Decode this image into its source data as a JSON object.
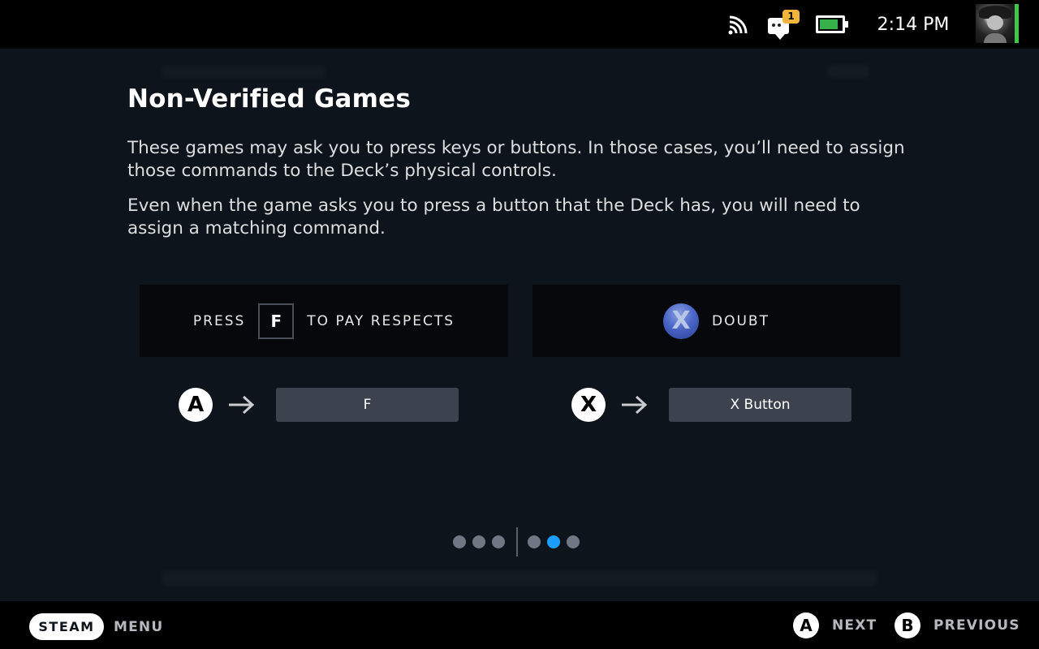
{
  "status_bar": {
    "cast_icon": "cast-icon",
    "notifications": {
      "icon": "chat-icon",
      "badge_count": "1",
      "badge_color": "#f1b53b"
    },
    "battery": {
      "icon": "battery-icon",
      "level_fraction": 0.85,
      "fill_color": "#37b24a"
    },
    "time": "2:14 PM",
    "avatar": "user-avatar",
    "online_indicator_color": "#3ec948"
  },
  "page": {
    "title": "Non-Verified Games",
    "paragraphs": [
      "These games may ask you to press keys or buttons. In those cases, you’ll need to assign those commands to the Deck’s physical controls.",
      "Even when the game asks you to press a button that the Deck has, you will need to assign a matching command."
    ]
  },
  "examples": [
    {
      "prompt_prefix": "PRESS",
      "prompt_key": "F",
      "prompt_suffix": "TO PAY RESPECTS",
      "mapping": {
        "deck_button": "A",
        "arrow_icon": "arrow-right-icon",
        "assigned": "F"
      }
    },
    {
      "prompt_icon": "X",
      "prompt_text": "DOUBT",
      "mapping": {
        "deck_button": "X",
        "arrow_icon": "arrow-right-icon",
        "assigned": "X Button"
      }
    }
  ],
  "pager": {
    "groups": [
      {
        "dots": 3,
        "active_index": null
      },
      {
        "dots": 3,
        "active_index": 1
      }
    ],
    "active_color": "#1a9fff",
    "current_page": 5,
    "total_pages": 6
  },
  "bottom_bar": {
    "steam_label": "STEAM",
    "menu_label": "MENU",
    "hints": [
      {
        "button": "A",
        "label": "NEXT"
      },
      {
        "button": "B",
        "label": "PREVIOUS"
      }
    ]
  }
}
